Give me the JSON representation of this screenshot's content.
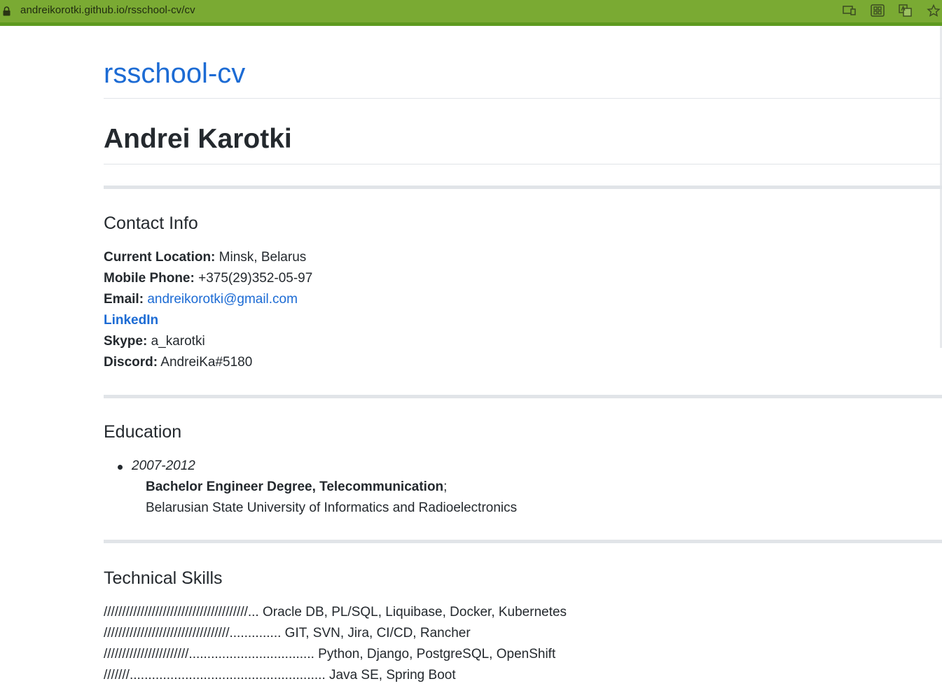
{
  "browser": {
    "url": "andreikorotki.github.io/rsschool-cv/cv",
    "icons": [
      "lock-icon",
      "cast-icon",
      "apps-icon",
      "translate-icon",
      "star-icon"
    ]
  },
  "page": {
    "site_title": "rsschool-cv",
    "name": "Andrei Karotki"
  },
  "contact": {
    "heading": "Contact Info",
    "location_label": "Current Location:",
    "location_value": " Minsk, Belarus",
    "phone_label": "Mobile Phone:",
    "phone_value": " +375(29)352-05-97",
    "email_label": "Email:",
    "email_value": "andreikorotki@gmail.com",
    "linkedin_label": "LinkedIn",
    "skype_label": "Skype:",
    "skype_value": " a_karotki",
    "discord_label": "Discord:",
    "discord_value": " AndreiKa#5180"
  },
  "education": {
    "heading": "Education",
    "items": [
      {
        "years": "2007-2012",
        "degree": "Bachelor Engineer Degree, Telecommunication",
        "degree_suffix": ";",
        "institution": "Belarusian State University of Informatics and Radioelectronics"
      }
    ]
  },
  "skills": {
    "heading": "Technical Skills",
    "rows": [
      {
        "bar": "///////////////////////////////////////...",
        "text": " Oracle DB, PL/SQL, Liquibase, Docker, Kubernetes"
      },
      {
        "bar": "//////////////////////////////////..............",
        "text": " GIT, SVN, Jira, CI/CD, Rancher"
      },
      {
        "bar": "///////////////////////..................................",
        "text": " Python, Django, PostgreSQL, OpenShift"
      },
      {
        "bar": "///////.....................................................",
        "text": " Java SE, Spring Boot"
      }
    ]
  },
  "colors": {
    "browser_bar": "#7aaa33",
    "link": "#1c6bd4",
    "text": "#24292e",
    "rule": "#e1e4e8"
  }
}
